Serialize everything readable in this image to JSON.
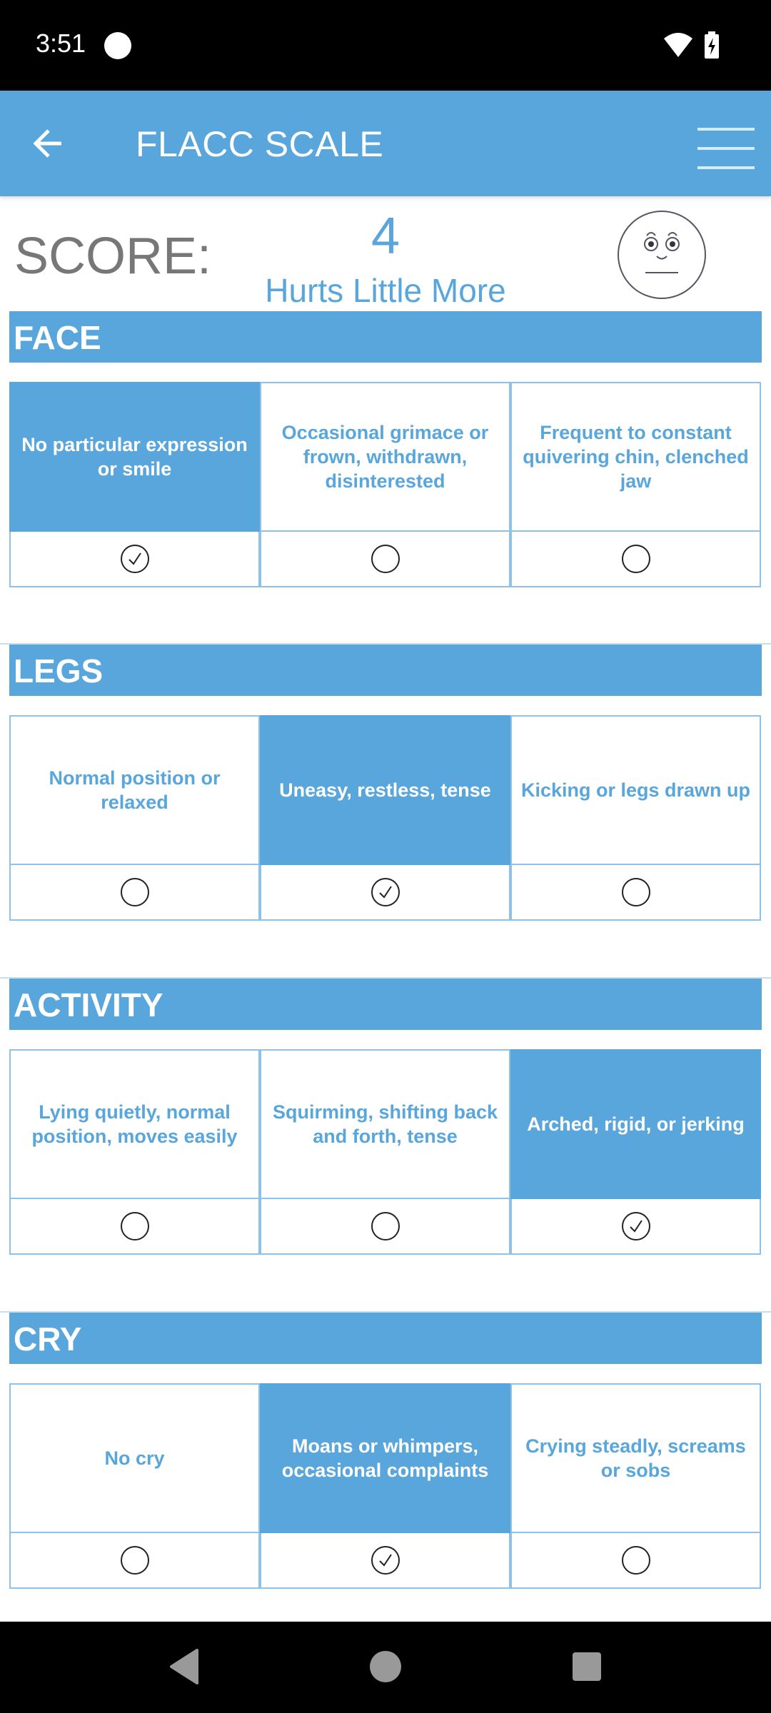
{
  "status_bar": {
    "time": "3:51"
  },
  "app_bar": {
    "title": "FLACC SCALE"
  },
  "score": {
    "label": "SCORE:",
    "value": "4",
    "description": "Hurts Little More"
  },
  "colors": {
    "accent": "#58A6DC",
    "status_bar": "#000000",
    "score_label": "#777777"
  },
  "sections": [
    {
      "title": "FACE",
      "selected": 0,
      "options": [
        "No particular expression or smile",
        "Occasional grimace or frown, withdrawn, disinterested",
        "Frequent to constant quivering chin, clenched jaw"
      ]
    },
    {
      "title": "LEGS",
      "selected": 1,
      "options": [
        "Normal position or relaxed",
        "Uneasy, restless, tense",
        "Kicking or legs drawn up"
      ]
    },
    {
      "title": "ACTIVITY",
      "selected": 2,
      "options": [
        "Lying quietly, normal position, moves easily",
        "Squirming, shifting back and forth, tense",
        "Arched, rigid, or jerking"
      ]
    },
    {
      "title": "CRY",
      "selected": 1,
      "options": [
        "No cry",
        "Moans or whimpers, occasional complaints",
        "Crying steadly, screams or sobs"
      ]
    }
  ]
}
